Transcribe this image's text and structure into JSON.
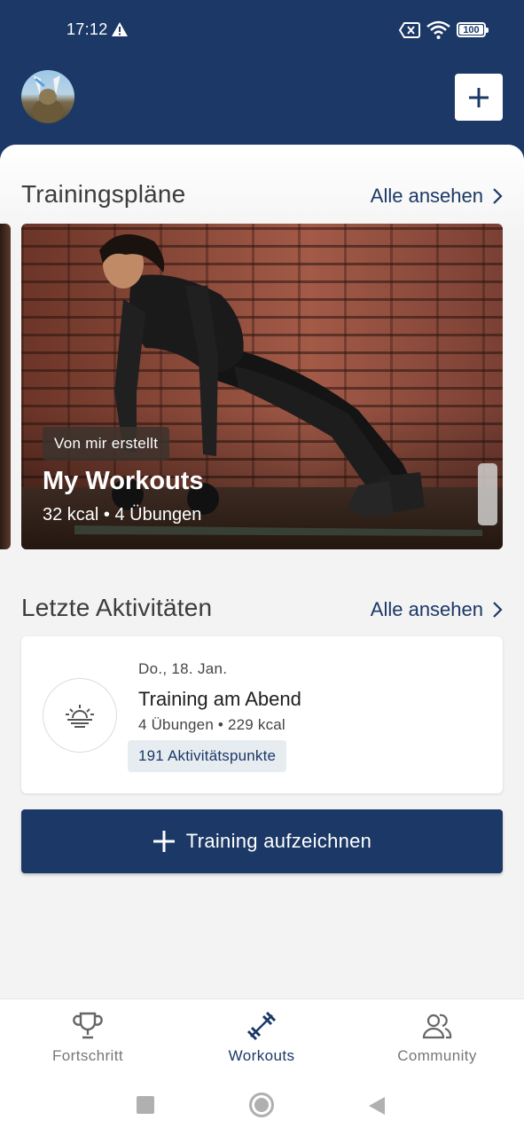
{
  "status_bar": {
    "time": "17:12",
    "battery": "100",
    "icons": [
      "warning-icon",
      "no-sim-icon",
      "wifi-icon",
      "battery-icon"
    ]
  },
  "header": {
    "add_icon": "plus-icon"
  },
  "training_plans": {
    "title": "Trainingspläne",
    "see_all": "Alle ansehen",
    "card": {
      "badge": "Von mir erstellt",
      "title": "My Workouts",
      "meta": "32 kcal • 4 Übungen"
    }
  },
  "recent_activities": {
    "title": "Letzte Aktivitäten",
    "see_all": "Alle ansehen",
    "items": [
      {
        "date": "Do., 18. Jan.",
        "title": "Training am Abend",
        "meta": "4 Übungen • 229 kcal",
        "points": "191 Aktivitätspunkte",
        "icon": "sunset-icon"
      }
    ]
  },
  "record_button": {
    "label": "Training aufzeichnen"
  },
  "bottom_nav": {
    "items": [
      {
        "label": "Fortschritt",
        "icon": "trophy-icon",
        "active": false
      },
      {
        "label": "Workouts",
        "icon": "dumbbell-icon",
        "active": true
      },
      {
        "label": "Community",
        "icon": "community-icon",
        "active": false
      }
    ]
  },
  "colors": {
    "primary": "#1b3866",
    "background": "#f3f3f3",
    "chip_bg": "#e7ecf1"
  }
}
